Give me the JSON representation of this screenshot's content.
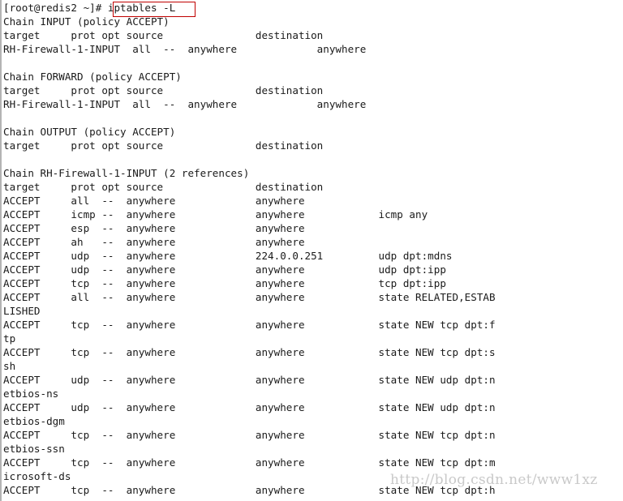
{
  "terminal": {
    "prompt": "[root@redis2 ~]# ",
    "command": "iptables -L",
    "highlight_color": "#c00000",
    "background_color": "#ffffff",
    "text_color": "#1a1a1a",
    "columns": 106,
    "lines": [
      "[root@redis2 ~]# iptables -L",
      "Chain INPUT (policy ACCEPT)",
      "target     prot opt source               destination",
      "RH-Firewall-1-INPUT  all  --  anywhere             anywhere",
      "",
      "Chain FORWARD (policy ACCEPT)",
      "target     prot opt source               destination",
      "RH-Firewall-1-INPUT  all  --  anywhere             anywhere",
      "",
      "Chain OUTPUT (policy ACCEPT)",
      "target     prot opt source               destination",
      "",
      "Chain RH-Firewall-1-INPUT (2 references)",
      "target     prot opt source               destination",
      "ACCEPT     all  --  anywhere             anywhere",
      "ACCEPT     icmp --  anywhere             anywhere            icmp any",
      "ACCEPT     esp  --  anywhere             anywhere",
      "ACCEPT     ah   --  anywhere             anywhere",
      "ACCEPT     udp  --  anywhere             224.0.0.251         udp dpt:mdns",
      "ACCEPT     udp  --  anywhere             anywhere            udp dpt:ipp",
      "ACCEPT     tcp  --  anywhere             anywhere            tcp dpt:ipp",
      "ACCEPT     all  --  anywhere             anywhere            state RELATED,ESTAB",
      "LISHED",
      "ACCEPT     tcp  --  anywhere             anywhere            state NEW tcp dpt:f",
      "tp",
      "ACCEPT     tcp  --  anywhere             anywhere            state NEW tcp dpt:s",
      "sh",
      "ACCEPT     udp  --  anywhere             anywhere            state NEW udp dpt:n",
      "etbios-ns",
      "ACCEPT     udp  --  anywhere             anywhere            state NEW udp dpt:n",
      "etbios-dgm",
      "ACCEPT     tcp  --  anywhere             anywhere            state NEW tcp dpt:n",
      "etbios-ssn",
      "ACCEPT     tcp  --  anywhere             anywhere            state NEW tcp dpt:m",
      "icrosoft-ds",
      "ACCEPT     tcp  --  anywhere             anywhere            state NEW tcp dpt:h"
    ]
  },
  "watermark": {
    "text": "http://blog.csdn.net/www1xz"
  }
}
